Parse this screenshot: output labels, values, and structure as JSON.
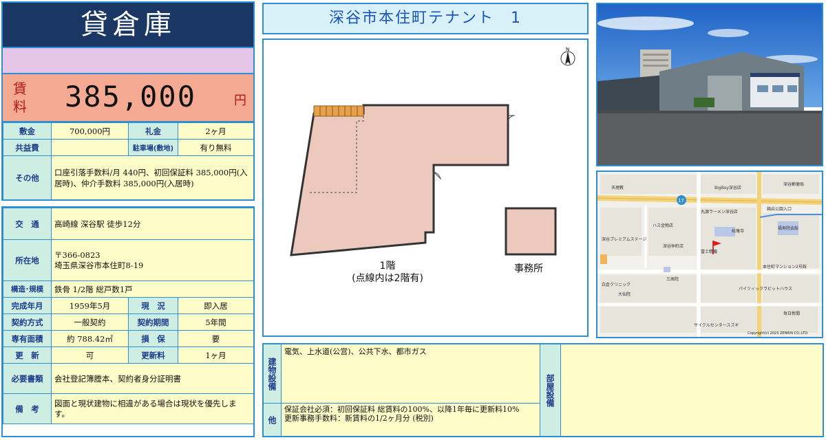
{
  "header": {
    "title": "貸倉庫"
  },
  "rent": {
    "label": "賃料",
    "value": "385,000",
    "unit": "円"
  },
  "terms": {
    "deposit_label": "敷金",
    "deposit_value": "700,000円",
    "key_money_label": "礼金",
    "key_money_value": "2ヶ月",
    "common_fee_label": "共益費",
    "common_fee_value": "",
    "parking_label": "駐車場(敷地)",
    "parking_value": "有り無料",
    "other_label": "その他",
    "other_value": "口座引落手数料/月 440円、初回保証料 385,000円(入居時)、仲介手数料 385,000円(入居時)"
  },
  "details": {
    "transport_label": "交　通",
    "transport_value": "高崎線 深谷駅 徒歩12分",
    "address_label": "所在地",
    "address_postal": "〒366-0823",
    "address_value": "埼玉県深谷市本住町8-19",
    "structure_label": "構造･規模",
    "structure_value": "鉄骨 1/2階 総戸数1戸",
    "built_label": "完成年月",
    "built_value": "1959年5月",
    "status_label": "現　況",
    "status_value": "即入居",
    "contract_label": "契約方式",
    "contract_value": "一般契約",
    "period_label": "契約期間",
    "period_value": "5年間",
    "area_label": "専有面積",
    "area_value": "約 788.42㎡",
    "insurance_label": "損　保",
    "insurance_value": "要",
    "renewal_label": "更　新",
    "renewal_value": "可",
    "renewal_fee_label": "更新料",
    "renewal_fee_value": "1ヶ月",
    "docs_label": "必要書類",
    "docs_value": "会社登記簿謄本、契約者身分証明書",
    "notes_label": "備　考",
    "notes_value": "図面と現状建物に相違がある場合は現状を優先します。"
  },
  "property_name": "深谷市本住町テナント　1",
  "floor_plan": {
    "floor1_label": "1階",
    "floor1_note": "(点線内は2階有)",
    "office_label": "事務所",
    "north_label": "N"
  },
  "facilities": {
    "building_label": "建物設備",
    "building_value": "電気、上水道(公営)、公共下水、都市ガス",
    "other_label": "他",
    "other_line1": "保証会社必須：初回保証料 総賃料の100%、以降1年毎に更新料10%",
    "other_line2": "更新事務手数料：新賃料の1/2ヶ月分 (税別)",
    "room_label": "部屋設備",
    "room_value": ""
  },
  "map": {
    "labels": [
      "天理教",
      "BigBoy深谷店",
      "深谷郵便局",
      "丸源ラーメン深谷店",
      "松庵寺",
      "ハス金物店",
      "深谷プレミアムステージ",
      "深谷仲町店",
      "富士精機",
      "三高院",
      "本住町マンション2号館",
      "パイツィックラビットハウス",
      "白倉クリニック",
      "大仙院",
      "サイクルセンタースズキ",
      "箱岩公園入口",
      "福寿院会館",
      "毎日新聞"
    ],
    "route_number": "17",
    "copyright": "Copyright(c) 2023 ZENRIN CO.,LTD."
  },
  "colors": {
    "title_bg": "#1b3764",
    "rent_bg": "#f4a992",
    "label_bg": "#cfeee3",
    "value_bg": "#fdfcc8",
    "border": "#2e8fd0"
  }
}
